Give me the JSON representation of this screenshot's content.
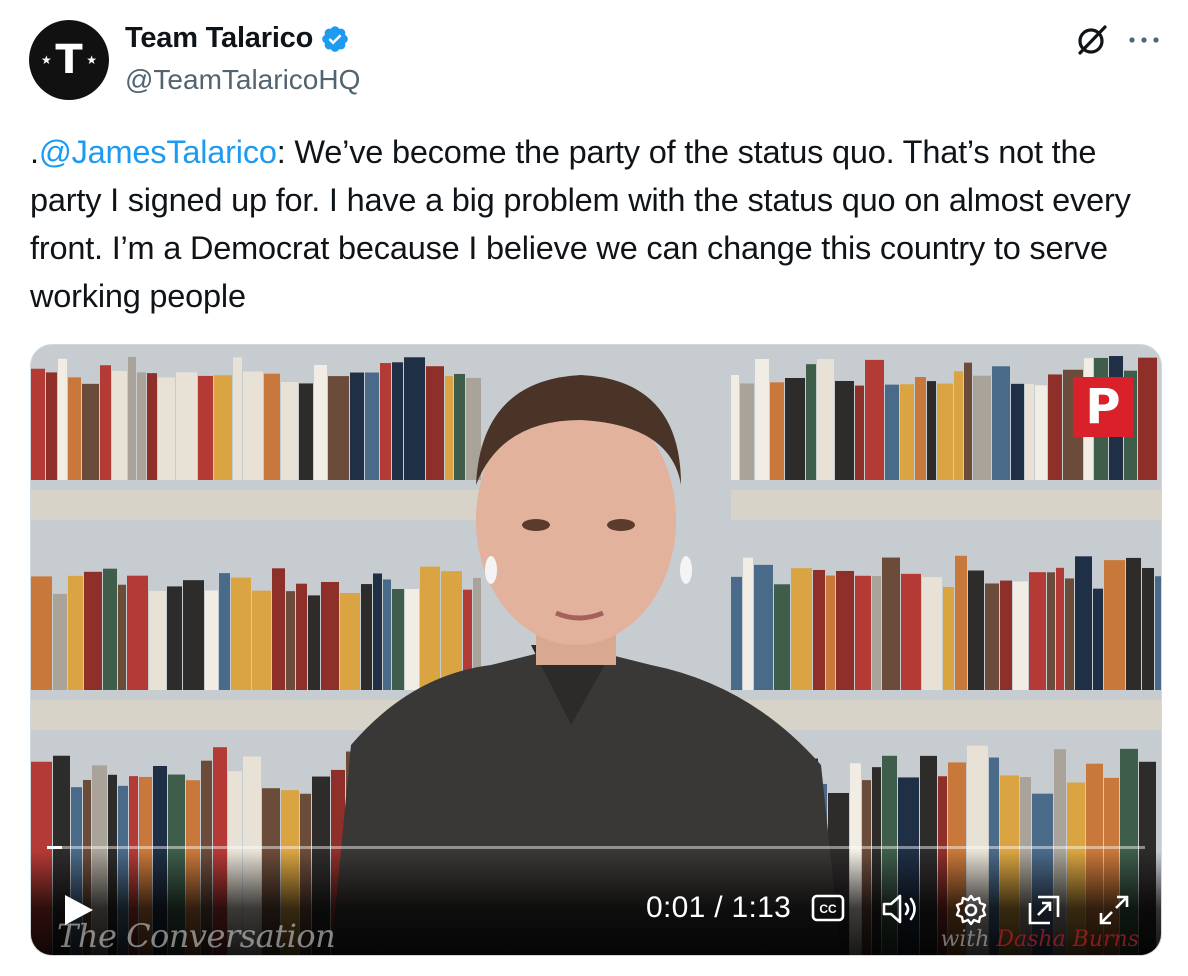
{
  "author": {
    "display_name": "Team Talarico",
    "handle": "@TeamTalaricoHQ",
    "avatar_letter": "T",
    "verified": true,
    "verified_color": "#1d9bf0"
  },
  "tweet": {
    "mention": "@JamesTalarico",
    "prefix": ".",
    "body": ": We’ve become the party of the status quo. That’s not the party I signed up for. I have a big problem with the status quo on almost every front. I’m a Democrat because I believe we can change this country to serve working people"
  },
  "header_icons": [
    "grok-icon",
    "more-icon"
  ],
  "video": {
    "current_time": "0:01",
    "separator": " / ",
    "duration": "1:13",
    "progress": 0.014,
    "channel_logo": "P",
    "watermark_left": "The Conversation",
    "watermark_right_prefix": "with ",
    "watermark_right_name": "Dasha Burns",
    "control_icons": [
      "play-icon",
      "captions-icon",
      "volume-icon",
      "settings-icon",
      "pip-icon",
      "fullscreen-icon"
    ],
    "captions_label": "CC"
  }
}
